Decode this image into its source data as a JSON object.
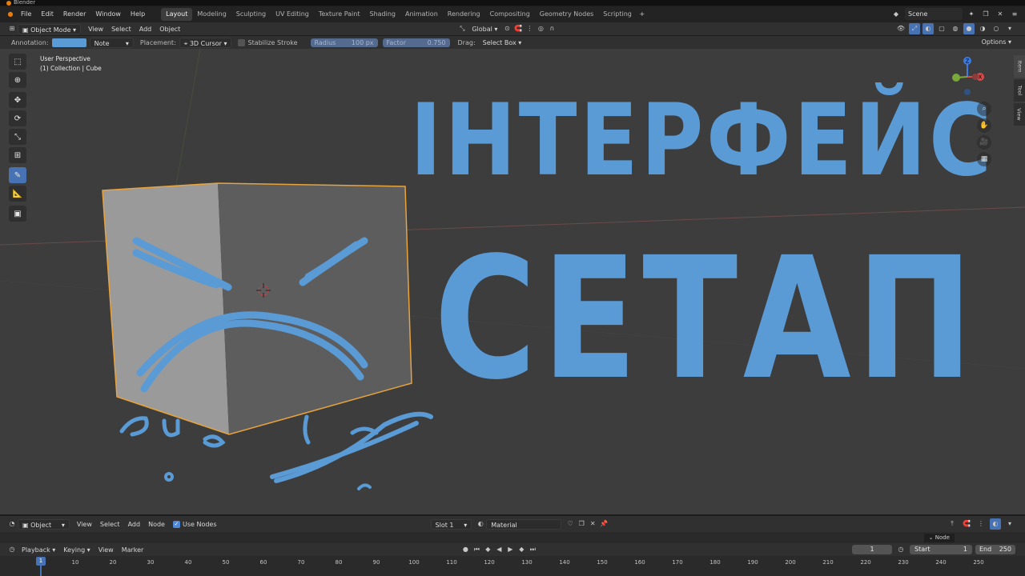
{
  "window": {
    "title": "Blender"
  },
  "menu": [
    "File",
    "Edit",
    "Render",
    "Window",
    "Help"
  ],
  "workspaces": [
    "Layout",
    "Modeling",
    "Sculpting",
    "UV Editing",
    "Texture Paint",
    "Shading",
    "Animation",
    "Rendering",
    "Compositing",
    "Geometry Nodes",
    "Scripting"
  ],
  "active_workspace": "Layout",
  "scene": {
    "name": "Scene"
  },
  "viewport_header": {
    "mode": "Object Mode",
    "menus": [
      "View",
      "Select",
      "Add",
      "Object"
    ],
    "transform_orientation": "Global"
  },
  "tool_settings": {
    "annotation_label": "Annotation:",
    "annotation_color": "#5a9bd6",
    "placement_target": "Note",
    "placement_label": "Placement:",
    "placement_value": "3D Cursor",
    "stabilize_label": "Stabilize Stroke",
    "radius_label": "Radius",
    "radius_value": "100 px",
    "factor_label": "Factor",
    "factor_value": "0.750",
    "drag_label": "Drag:",
    "drag_value": "Select Box",
    "options_label": "Options"
  },
  "viewport": {
    "perspective": "User Perspective",
    "collection": "(1) Collection | Cube",
    "side_tabs": [
      "Item",
      "Tool",
      "View"
    ],
    "annotation_text_line1": "ІНТЕРФЕЙС",
    "annotation_text_line2": "СЕТАП",
    "stroke_color": "#5a9bd6",
    "selection_color": "#e8a33c"
  },
  "node_editor": {
    "type": "Object",
    "menus": [
      "View",
      "Select",
      "Add",
      "Node"
    ],
    "use_nodes_label": "Use Nodes",
    "slot": "Slot 1",
    "material": "Material",
    "panel_tab": "Node"
  },
  "timeline": {
    "menus": [
      "Playback",
      "Keying",
      "View",
      "Marker"
    ],
    "current_frame": "1",
    "start_label": "Start",
    "start_value": "1",
    "end_label": "End",
    "end_value": "250",
    "ruler_ticks": [
      "10",
      "20",
      "30",
      "40",
      "50",
      "60",
      "70",
      "80",
      "90",
      "100",
      "110",
      "120",
      "130",
      "140",
      "150",
      "160",
      "170",
      "180",
      "190",
      "200",
      "210",
      "220",
      "230",
      "240",
      "250"
    ]
  }
}
